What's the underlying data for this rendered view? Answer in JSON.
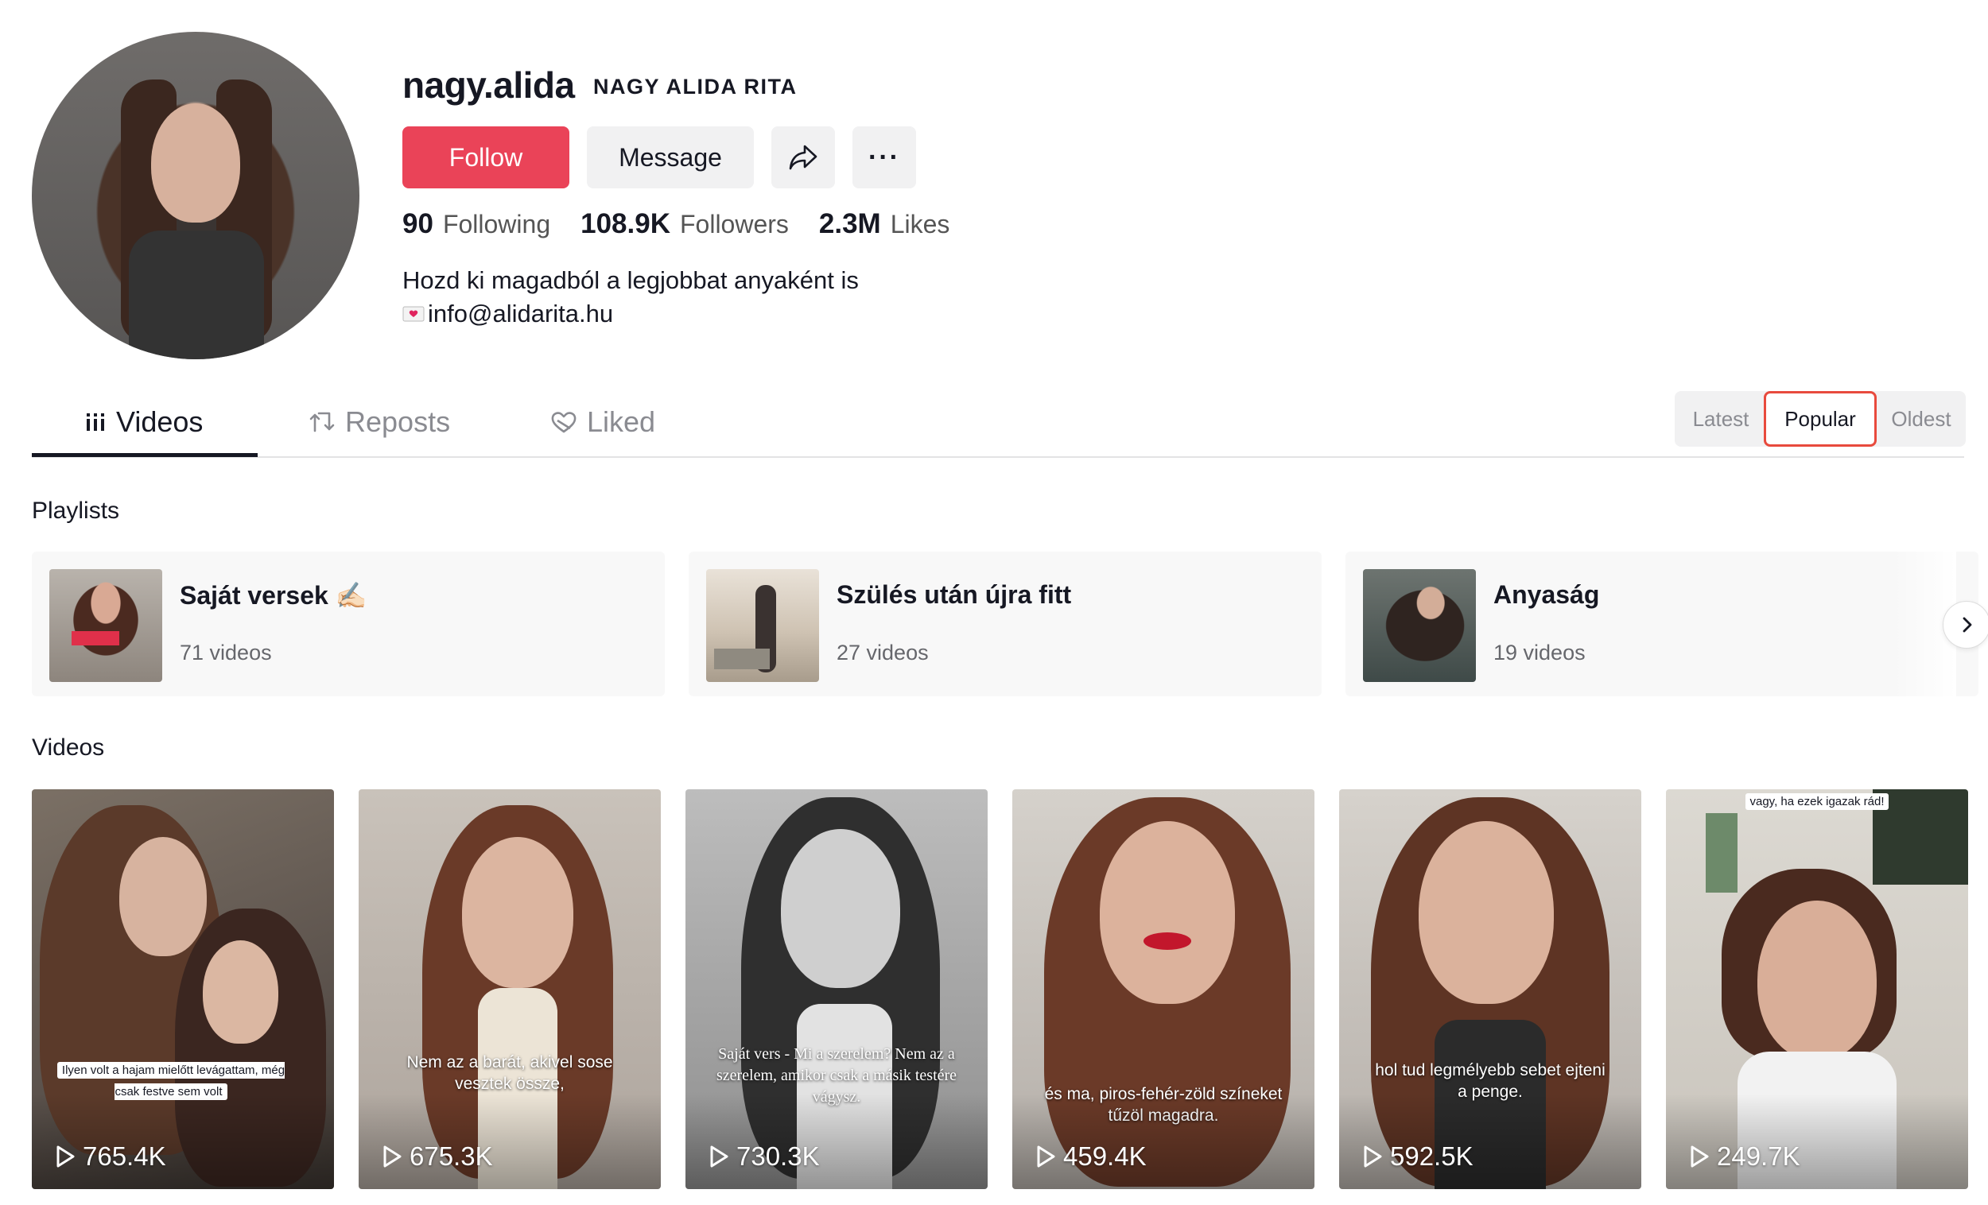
{
  "profile": {
    "username": "nagy.alida",
    "nickname": "NAGY ALIDA RITA",
    "follow_label": "Follow",
    "message_label": "Message",
    "share_icon": "share-icon",
    "more_label": "···",
    "stats": {
      "following_count": "90",
      "following_label": "Following",
      "followers_count": "108.9K",
      "followers_label": "Followers",
      "likes_count": "2.3M",
      "likes_label": "Likes"
    },
    "bio_line1": "Hozd ki magadból a legjobbat anyaként is",
    "bio_line2": "info@alidarita.hu"
  },
  "tabs": {
    "videos": "Videos",
    "reposts": "Reposts",
    "liked": "Liked"
  },
  "sort": {
    "latest": "Latest",
    "popular": "Popular",
    "oldest": "Oldest",
    "selected": "Popular"
  },
  "playlists": {
    "title": "Playlists",
    "items": [
      {
        "name": "Saját versek ✍🏻",
        "count": "71 videos"
      },
      {
        "name": "Szülés után újra fitt",
        "count": "27 videos"
      },
      {
        "name": "Anyaság",
        "count": "19 videos"
      }
    ]
  },
  "videos": {
    "title": "Videos",
    "items": [
      {
        "views": "765.4K",
        "caption": "Ilyen volt a hajam mielőtt levágattam, még csak festve sem volt"
      },
      {
        "views": "675.3K",
        "caption": "Nem az a barát, akivel sose vesztek össze,"
      },
      {
        "views": "730.3K",
        "caption": "Saját vers - Mi a szerelem? Nem az a szerelem, amikor csak a másik testére vágysz."
      },
      {
        "views": "459.4K",
        "caption": "és ma, piros-fehér-zöld színeket tűzöl magadra."
      },
      {
        "views": "592.5K",
        "caption": "hol tud legmélyebb sebet ejteni a penge."
      },
      {
        "views": "249.7K",
        "caption": "vagy, ha ezek igazak rád!"
      }
    ]
  },
  "colors": {
    "accent": "#ea4358",
    "selected_outline": "#e84a3d"
  }
}
